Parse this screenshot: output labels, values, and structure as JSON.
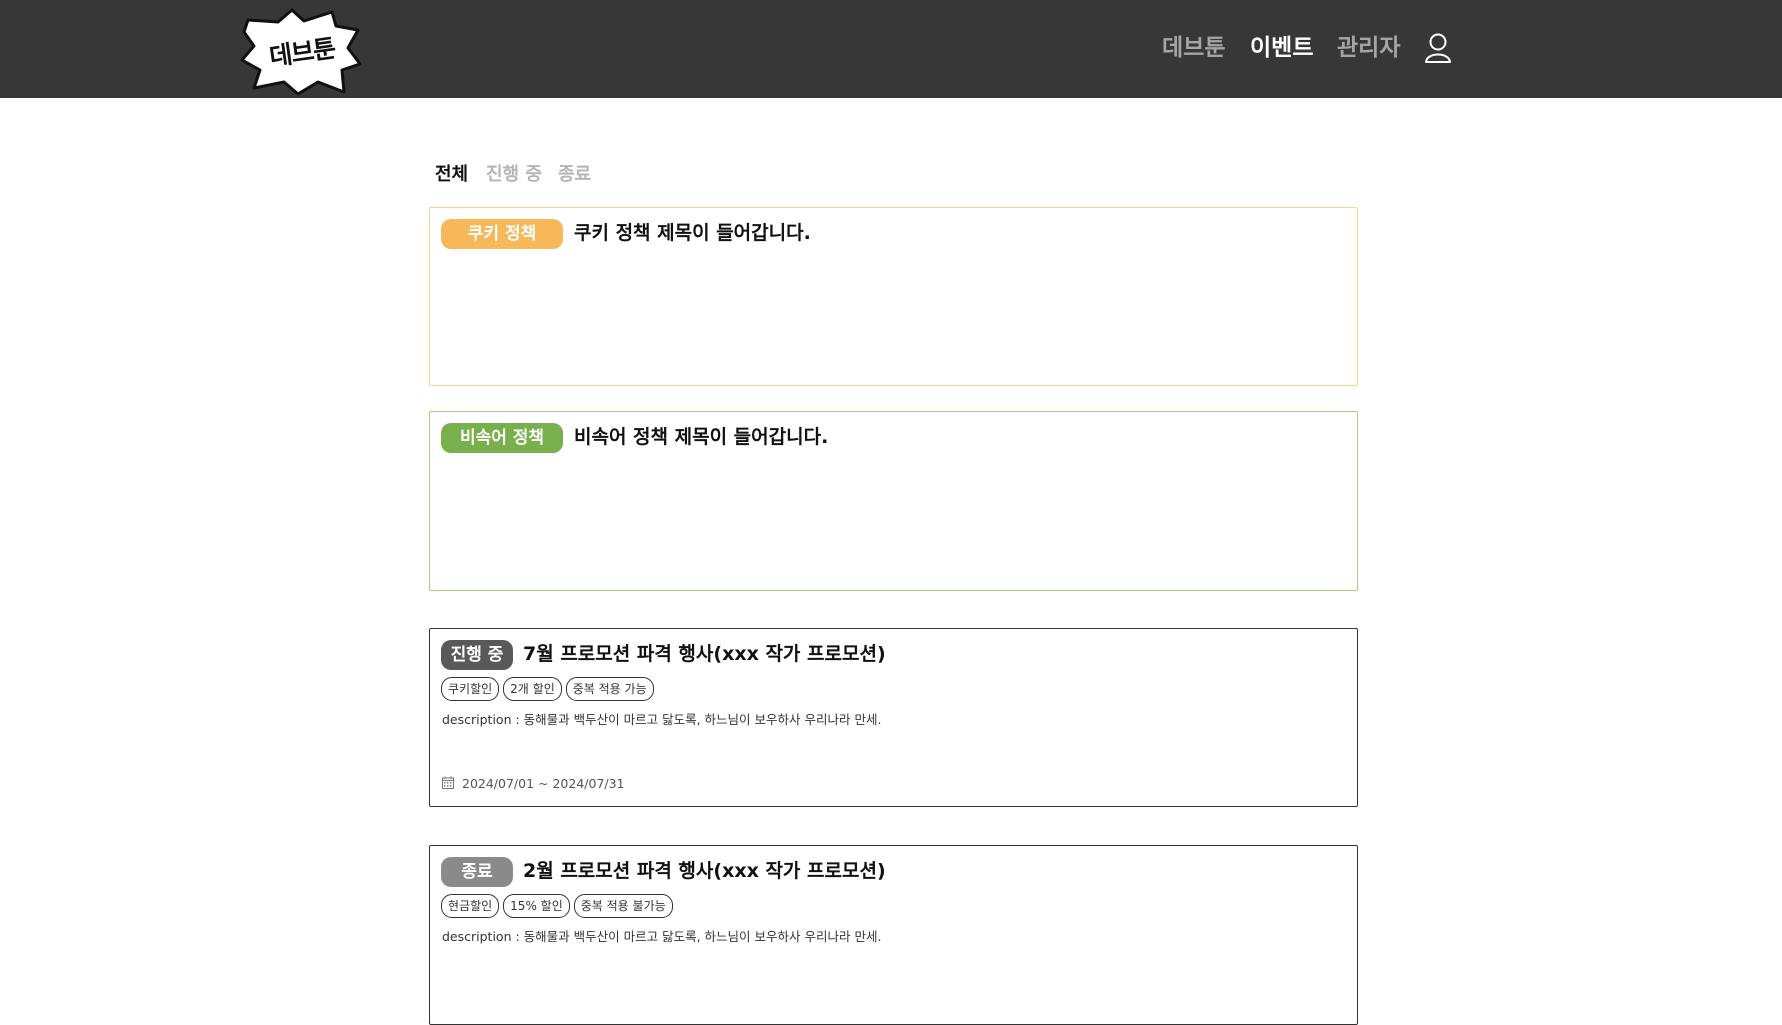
{
  "header": {
    "logo_text": "데브툰",
    "nav": [
      {
        "label": "데브툰",
        "active": false
      },
      {
        "label": "이벤트",
        "active": true
      },
      {
        "label": "관리자",
        "active": false
      }
    ],
    "user_icon": "user-icon"
  },
  "filters": [
    {
      "label": "전체",
      "active": true
    },
    {
      "label": "진행 중",
      "active": false
    },
    {
      "label": "종료",
      "active": false
    }
  ],
  "policies": [
    {
      "badge": "쿠키 정책",
      "title": "쿠키 정책 제목이 들어갑니다.",
      "color": "#f7b85a"
    },
    {
      "badge": "비속어 정책",
      "title": "비속어 정책 제목이 들어갑니다.",
      "color": "#7aaf4e"
    }
  ],
  "events": [
    {
      "status": "진행 중",
      "status_color": "#595959",
      "title": "7월 프로모션 파격 행사(xxx 작가 프로모션)",
      "tags": [
        "쿠키할인",
        "2개 할인",
        "중복 적용 가능"
      ],
      "description": "description : 동해물과 백두산이 마르고 닳도록, 하느님이 보우하사 우리나라 만세.",
      "dates": "2024/07/01 ~ 2024/07/31"
    },
    {
      "status": "종료",
      "status_color": "#8a8a8a",
      "title": "2월 프로모션 파격 행사(xxx 작가 프로모션)",
      "tags": [
        "현금할인",
        "15% 할인",
        "중복 적용 불가능"
      ],
      "description": "description : 동해물과 백두산이 마르고 닳도록, 하느님이 보우하사 우리나라 만세."
    }
  ]
}
